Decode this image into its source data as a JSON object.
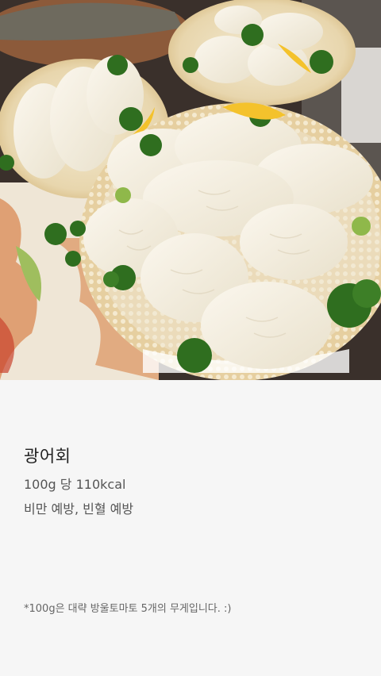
{
  "food_card": {
    "image_alt": "광어회",
    "title": "광어회",
    "calories": "100g 당 110kcal",
    "benefits": "비만 예방, 빈혈 예방",
    "footnote": "*100g은 대략 방울토마토 5개의 무게입니다. :)"
  }
}
